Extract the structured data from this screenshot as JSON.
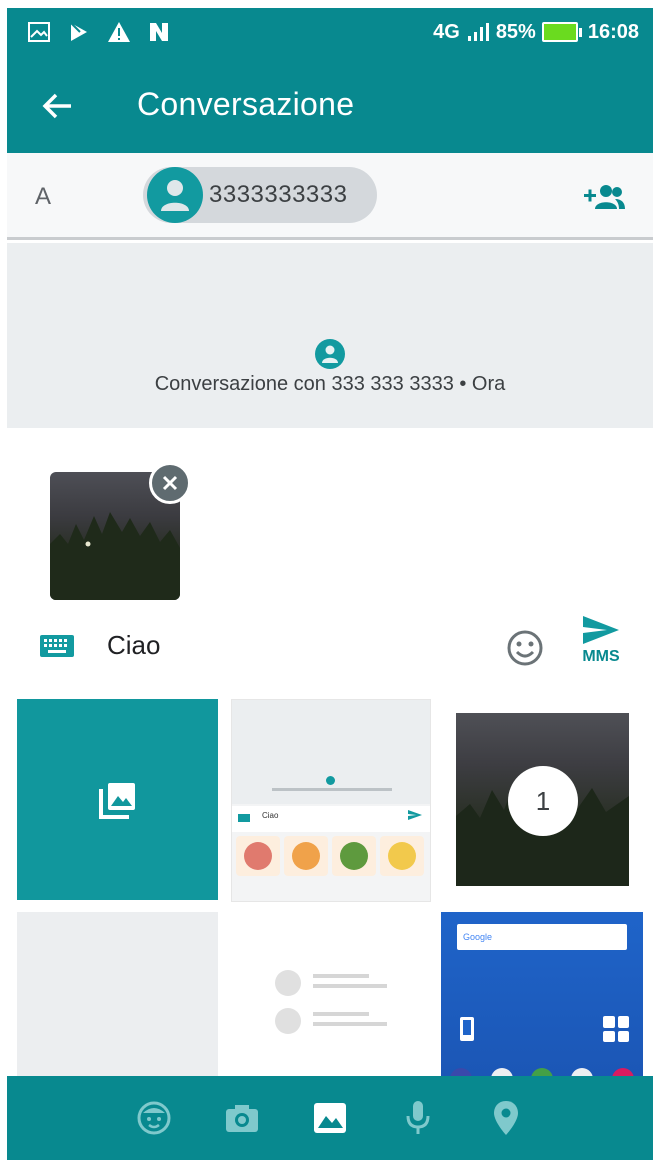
{
  "status_bar": {
    "network": "4G",
    "battery": "85%",
    "time": "16:08"
  },
  "app_bar": {
    "title": "Conversazione"
  },
  "recipient": {
    "to_label": "A",
    "chip": "3333333333"
  },
  "conversation": {
    "info": "Conversazione con 333 333 3333 • Ora"
  },
  "compose": {
    "text": "Ciao",
    "send_label": "MMS"
  },
  "gallery": {
    "selected_count": "1",
    "home_search": "Google"
  },
  "colors": {
    "primary": "#08898f",
    "accent": "#129aa0",
    "battery": "#6adb1f"
  },
  "icons": {
    "bottom_nav": [
      "sticker-icon",
      "camera-icon",
      "gallery-icon",
      "microphone-icon",
      "location-icon"
    ]
  }
}
